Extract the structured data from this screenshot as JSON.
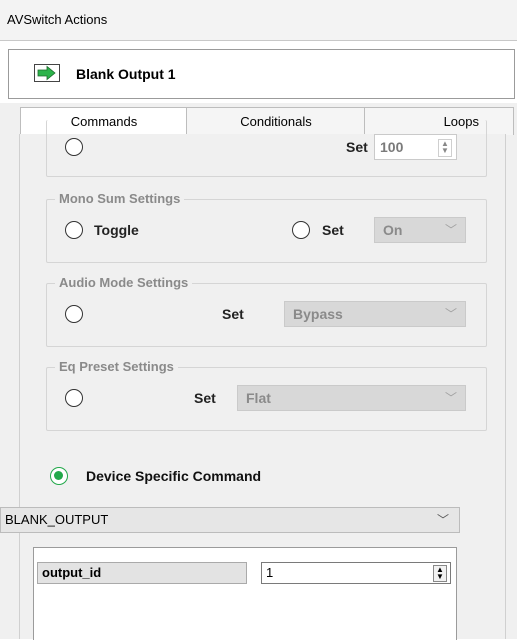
{
  "window": {
    "title": "AVSwitch Actions"
  },
  "action": {
    "title": "Blank Output 1"
  },
  "tabs": [
    {
      "label": "Commands"
    },
    {
      "label": "Conditionals"
    },
    {
      "label": "Loops"
    }
  ],
  "volume_group": {
    "set_label": "Set",
    "value": "100"
  },
  "mono_sum": {
    "legend": "Mono Sum Settings",
    "toggle_label": "Toggle",
    "set_label": "Set",
    "value": "On"
  },
  "audio_mode": {
    "legend": "Audio Mode Settings",
    "set_label": "Set",
    "value": "Bypass"
  },
  "eq_preset": {
    "legend": "Eq Preset Settings",
    "set_label": "Set",
    "value": "Flat"
  },
  "device_specific": {
    "label": "Device Specific Command",
    "command": "BLANK_OUTPUT"
  },
  "parameters": [
    {
      "name": "output_id",
      "value": "1"
    }
  ],
  "colors": {
    "radio_selected": "#22a84a",
    "arrow_green": "#2cb34a",
    "disabled_field": "#d8d8d8"
  }
}
